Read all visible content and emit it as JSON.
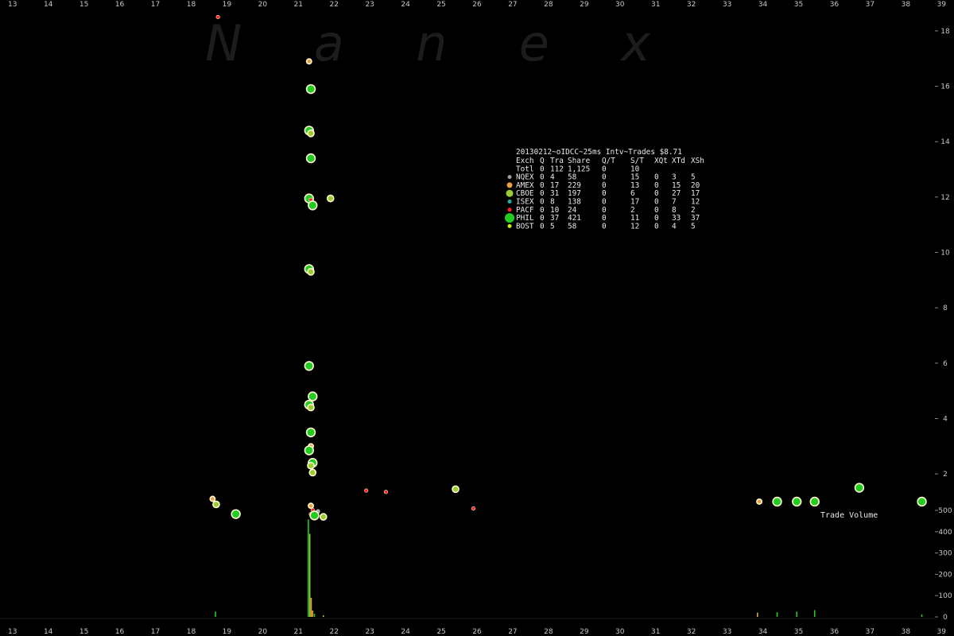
{
  "watermark": "N a n e x",
  "chart_data": {
    "type": "scatter",
    "title": "20130212~oIDCC~25ms Intv~Trades $8.71",
    "x_ticks": [
      "13",
      "14",
      "15",
      "16",
      "17",
      "18",
      "19",
      "20",
      "21",
      "22",
      "23",
      "24",
      "25",
      "26",
      "27",
      "28",
      "29",
      "30",
      "31",
      "32",
      "33",
      "34",
      "35",
      "36",
      "37",
      "38",
      "39"
    ],
    "price_ticks": [
      "2",
      "4",
      "6",
      "8",
      "10",
      "12",
      "14",
      "16",
      "18"
    ],
    "volume_ticks": [
      "0",
      "100",
      "200",
      "300",
      "400",
      "500"
    ],
    "xlim": [
      12.65,
      39.35
    ],
    "price_ylim": [
      1.2,
      18.6
    ],
    "volume_ylim": [
      0,
      500
    ],
    "volume_label": "Trade Volume",
    "grid": false,
    "exchange_colors": {
      "NQEX": "#a0a0a0",
      "AMEX": "#e8a040",
      "CBOE": "#9acd32",
      "ISEX": "#20b2aa",
      "PACF": "#ff2020",
      "PHIL": "#22cc22",
      "BOST": "#c8f000"
    },
    "legend": {
      "header": [
        "Exch",
        "Q",
        "Tra",
        "Share",
        "Q/T",
        "S/T",
        "XQt",
        "XTd",
        "XSh"
      ],
      "total": [
        "Totl",
        "0",
        "112",
        "1,125",
        "0",
        "10",
        "",
        "",
        ""
      ],
      "rows": [
        {
          "exch": "NQEX",
          "cells": [
            "0",
            "4",
            "58",
            "0",
            "15",
            "0",
            "3",
            "5"
          ],
          "marker_size": 2.5
        },
        {
          "exch": "AMEX",
          "cells": [
            "0",
            "17",
            "229",
            "0",
            "13",
            "0",
            "15",
            "20"
          ],
          "marker_size": 3.5
        },
        {
          "exch": "CBOE",
          "cells": [
            "0",
            "31",
            "197",
            "0",
            "6",
            "0",
            "27",
            "17"
          ],
          "marker_size": 4.5
        },
        {
          "exch": "ISEX",
          "cells": [
            "0",
            "8",
            "138",
            "0",
            "17",
            "0",
            "7",
            "12"
          ],
          "marker_size": 2.5
        },
        {
          "exch": "PACF",
          "cells": [
            "0",
            "10",
            "24",
            "0",
            "2",
            "0",
            "8",
            "2"
          ],
          "marker_size": 2.5
        },
        {
          "exch": "PHIL",
          "cells": [
            "0",
            "37",
            "421",
            "0",
            "11",
            "0",
            "33",
            "37"
          ],
          "marker_size": 6
        },
        {
          "exch": "BOST",
          "cells": [
            "0",
            "5",
            "58",
            "0",
            "12",
            "0",
            "4",
            "5"
          ],
          "marker_size": 2.5
        }
      ]
    },
    "trades": [
      {
        "x": 18.75,
        "y": 18.5,
        "exch": "PACF"
      },
      {
        "x": 21.3,
        "y": 16.9,
        "exch": "AMEX"
      },
      {
        "x": 21.35,
        "y": 15.9,
        "exch": "PHIL"
      },
      {
        "x": 21.3,
        "y": 14.4,
        "exch": "PHIL"
      },
      {
        "x": 21.35,
        "y": 14.3,
        "exch": "CBOE"
      },
      {
        "x": 21.35,
        "y": 13.4,
        "exch": "PHIL"
      },
      {
        "x": 21.3,
        "y": 11.95,
        "exch": "PHIL"
      },
      {
        "x": 21.35,
        "y": 11.9,
        "exch": "PACF"
      },
      {
        "x": 21.4,
        "y": 11.7,
        "exch": "PHIL"
      },
      {
        "x": 21.9,
        "y": 11.95,
        "exch": "CBOE"
      },
      {
        "x": 21.3,
        "y": 9.4,
        "exch": "PHIL"
      },
      {
        "x": 21.35,
        "y": 9.3,
        "exch": "CBOE"
      },
      {
        "x": 21.3,
        "y": 5.9,
        "exch": "PHIL"
      },
      {
        "x": 21.4,
        "y": 4.8,
        "exch": "PHIL"
      },
      {
        "x": 21.3,
        "y": 4.5,
        "exch": "PHIL"
      },
      {
        "x": 21.35,
        "y": 4.4,
        "exch": "CBOE"
      },
      {
        "x": 21.35,
        "y": 3.5,
        "exch": "PHIL"
      },
      {
        "x": 21.35,
        "y": 3.0,
        "exch": "AMEX"
      },
      {
        "x": 21.3,
        "y": 2.85,
        "exch": "PHIL"
      },
      {
        "x": 21.4,
        "y": 2.4,
        "exch": "PHIL"
      },
      {
        "x": 21.35,
        "y": 2.3,
        "exch": "CBOE"
      },
      {
        "x": 21.4,
        "y": 2.05,
        "exch": "CBOE"
      },
      {
        "x": 18.6,
        "y": 1.1,
        "exch": "AMEX"
      },
      {
        "x": 18.7,
        "y": 0.9,
        "exch": "CBOE"
      },
      {
        "x": 19.25,
        "y": 0.55,
        "exch": "PHIL"
      },
      {
        "x": 21.35,
        "y": 0.85,
        "exch": "AMEX"
      },
      {
        "x": 21.4,
        "y": 0.7,
        "exch": "PACF"
      },
      {
        "x": 21.55,
        "y": 0.65,
        "exch": "NQEX"
      },
      {
        "x": 21.35,
        "y": 0.55,
        "exch": "PACF"
      },
      {
        "x": 21.45,
        "y": 0.5,
        "exch": "PHIL"
      },
      {
        "x": 21.7,
        "y": 0.45,
        "exch": "CBOE"
      },
      {
        "x": 22.9,
        "y": 1.4,
        "exch": "PACF"
      },
      {
        "x": 23.45,
        "y": 1.35,
        "exch": "PACF"
      },
      {
        "x": 25.4,
        "y": 1.45,
        "exch": "CBOE"
      },
      {
        "x": 25.9,
        "y": 0.75,
        "exch": "PACF"
      },
      {
        "x": 33.9,
        "y": 1.0,
        "exch": "AMEX"
      },
      {
        "x": 34.4,
        "y": 1.0,
        "exch": "PHIL"
      },
      {
        "x": 34.95,
        "y": 1.0,
        "exch": "PHIL"
      },
      {
        "x": 35.45,
        "y": 1.0,
        "exch": "PHIL"
      },
      {
        "x": 36.7,
        "y": 1.5,
        "exch": "PHIL"
      },
      {
        "x": 38.45,
        "y": 1.0,
        "exch": "PHIL"
      }
    ],
    "volume_bars": [
      {
        "x": 18.68,
        "v": 25,
        "exch": "PHIL"
      },
      {
        "x": 21.28,
        "v": 458,
        "exch": "PHIL"
      },
      {
        "x": 21.32,
        "v": 390,
        "exch": "CBOE"
      },
      {
        "x": 21.36,
        "v": 90,
        "exch": "AMEX"
      },
      {
        "x": 21.4,
        "v": 30,
        "exch": "AMEX"
      },
      {
        "x": 21.45,
        "v": 15,
        "exch": "PHIL"
      },
      {
        "x": 21.7,
        "v": 8,
        "exch": "CBOE"
      },
      {
        "x": 33.85,
        "v": 20,
        "exch": "AMEX"
      },
      {
        "x": 34.4,
        "v": 22,
        "exch": "PHIL"
      },
      {
        "x": 34.95,
        "v": 25,
        "exch": "PHIL"
      },
      {
        "x": 35.45,
        "v": 32,
        "exch": "PHIL"
      },
      {
        "x": 38.45,
        "v": 12,
        "exch": "PHIL"
      }
    ]
  }
}
